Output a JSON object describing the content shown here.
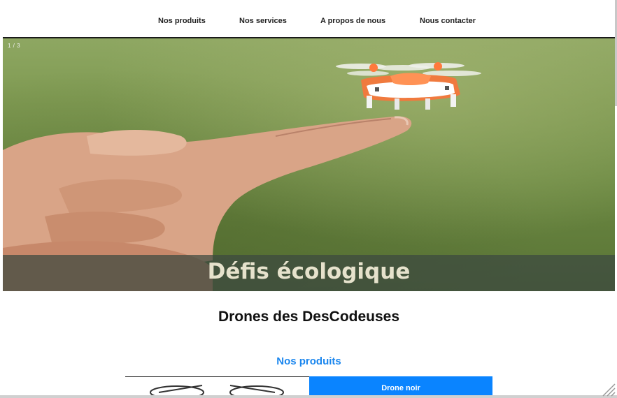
{
  "nav": {
    "items": [
      {
        "label": "Nos produits"
      },
      {
        "label": "Nos services"
      },
      {
        "label": "A propos de nous"
      },
      {
        "label": "Nous contacter"
      }
    ]
  },
  "hero": {
    "slide_counter": "1 / 3",
    "caption": "Défis écologique",
    "current_slide": 1,
    "total_slides": 3
  },
  "main": {
    "site_title": "Drones des DesCodeuses",
    "products_heading": "Nos produits",
    "products": [
      {
        "name": "Drone noir"
      }
    ]
  },
  "colors": {
    "accent": "#0a84ff",
    "heading_blue": "#1a86ee",
    "caption_overlay": "#3c4840",
    "caption_text": "#e6e2cc"
  }
}
